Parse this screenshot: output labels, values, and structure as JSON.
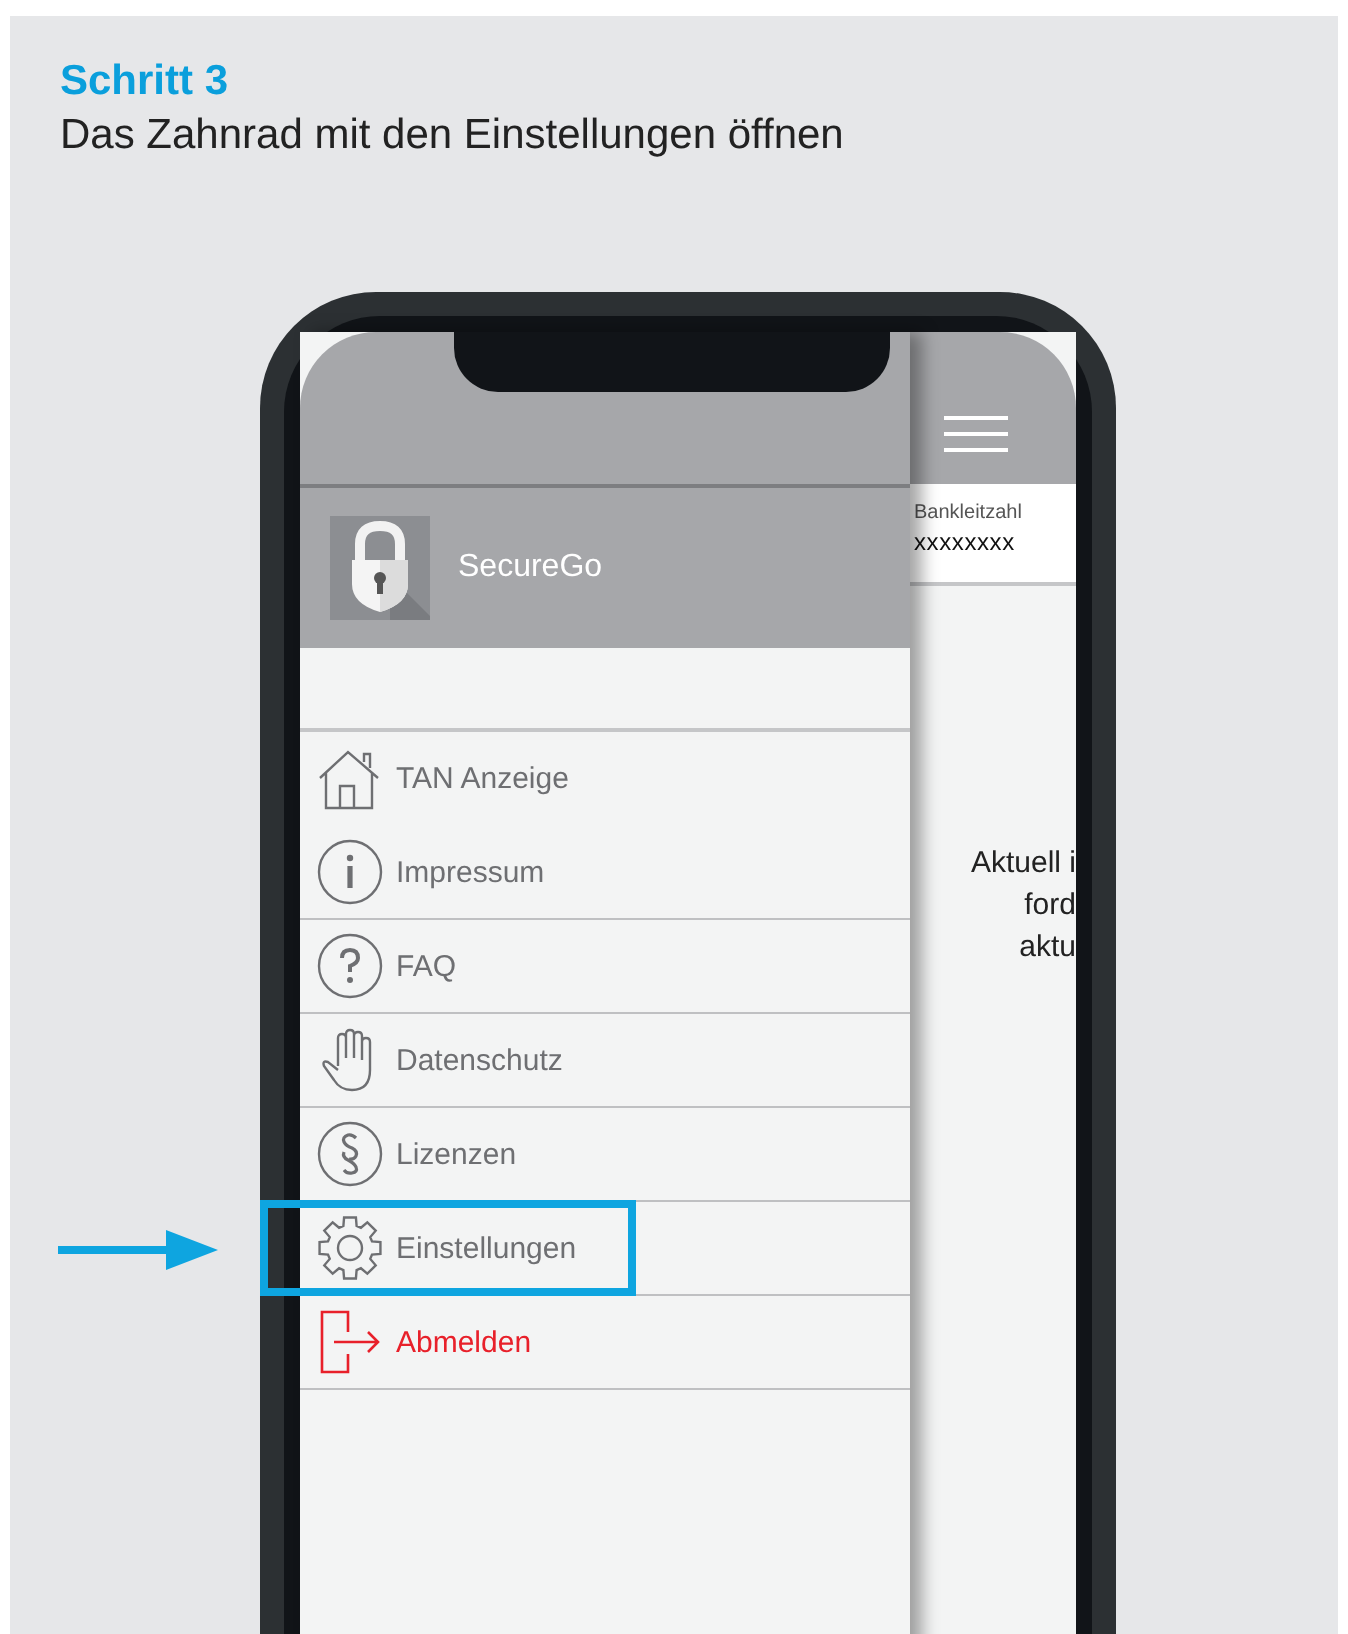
{
  "heading": {
    "step": "Schritt 3",
    "instruction": "Das Zahnrad mit den Einstellungen öffnen"
  },
  "drawer": {
    "app_name": "SecureGo",
    "items": [
      {
        "label": "TAN Anzeige",
        "kind": "normal",
        "highlighted": false
      },
      {
        "label": "Impressum",
        "kind": "normal",
        "highlighted": false
      },
      {
        "label": "FAQ",
        "kind": "normal",
        "highlighted": false
      },
      {
        "label": "Datenschutz",
        "kind": "normal",
        "highlighted": false
      },
      {
        "label": "Lizenzen",
        "kind": "normal",
        "highlighted": false
      },
      {
        "label": "Einstellungen",
        "kind": "normal",
        "highlighted": true
      },
      {
        "label": "Abmelden",
        "kind": "logout",
        "highlighted": false
      }
    ]
  },
  "main": {
    "field_label": "Bankleitzahl",
    "field_value": "xxxxxxxx",
    "message_lines": [
      "Aktuell i",
      "ford",
      "aktu"
    ]
  }
}
